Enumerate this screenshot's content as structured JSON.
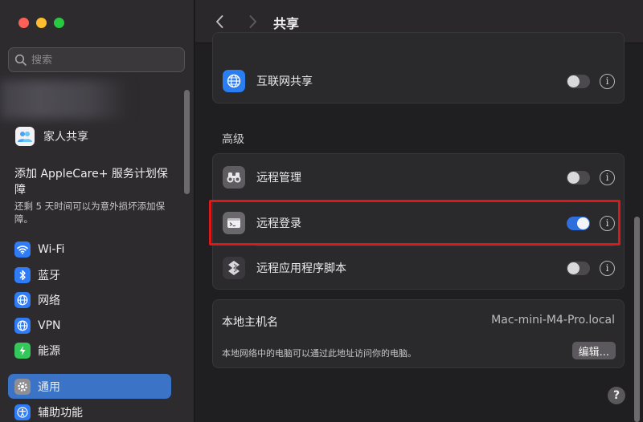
{
  "sidebar": {
    "search_placeholder": "搜索",
    "family_label": "家人共享",
    "applecare": {
      "title": "添加 AppleCare+ 服务计划保障",
      "subtitle": "还剩 5 天时间可以为意外损坏添加保障。"
    },
    "items": [
      {
        "label": "Wi-Fi",
        "icon": "wifi-icon",
        "color": "#2f7cf6"
      },
      {
        "label": "蓝牙",
        "icon": "bluetooth-icon",
        "color": "#2f7cf6"
      },
      {
        "label": "网络",
        "icon": "globe-icon",
        "color": "#2f7cf6"
      },
      {
        "label": "VPN",
        "icon": "vpn-icon",
        "color": "#2f7cf6"
      },
      {
        "label": "能源",
        "icon": "battery-icon",
        "color": "#34c759"
      },
      {
        "label": "通用",
        "icon": "gear-icon",
        "color": "#8e8e93",
        "active": true
      },
      {
        "label": "辅助功能",
        "icon": "accessibility-icon",
        "color": "#2f7cf6"
      }
    ]
  },
  "header": {
    "title": "共享"
  },
  "sharing_top": {
    "label": "互联网共享",
    "enabled": false
  },
  "advanced": {
    "header": "高级",
    "items": [
      {
        "label": "远程管理",
        "icon": "binoculars-icon",
        "enabled": false
      },
      {
        "label": "远程登录",
        "icon": "terminal-icon",
        "enabled": true
      },
      {
        "label": "远程应用程序脚本",
        "icon": "script-icon",
        "enabled": false
      }
    ]
  },
  "hostname": {
    "label": "本地主机名",
    "value": "Mac-mini-M4-Pro.local",
    "description": "本地网络中的电脑可以通过此地址访问你的电脑。",
    "edit_label": "编辑..."
  },
  "help_label": "?",
  "info_label": "i",
  "colors": {
    "accent": "#2f6fdc",
    "highlight_border": "#e01717"
  }
}
